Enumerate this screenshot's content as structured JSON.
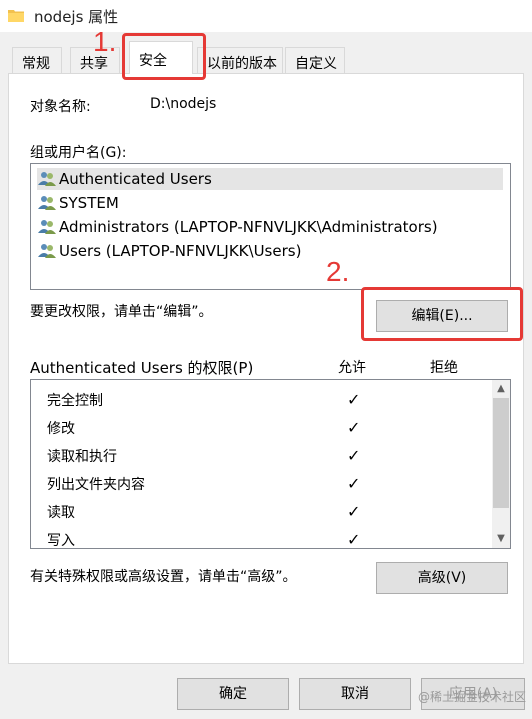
{
  "window": {
    "title": "nodejs 属性",
    "folder_icon": "folder-icon"
  },
  "tabs": [
    {
      "label": "常规",
      "active": false
    },
    {
      "label": "共享",
      "active": false
    },
    {
      "label": "安全",
      "active": true
    },
    {
      "label": "以前的版本",
      "active": false
    },
    {
      "label": "自定义",
      "active": false
    }
  ],
  "security": {
    "object_name_label": "对象名称:",
    "object_name_value": "D:\\nodejs",
    "groups_label": "组或用户名(G):",
    "groups": [
      {
        "name": "Authenticated Users",
        "selected": true,
        "icon": "users-icon"
      },
      {
        "name": "SYSTEM",
        "selected": false,
        "icon": "users-icon"
      },
      {
        "name": "Administrators (LAPTOP-NFNVLJKK\\Administrators)",
        "selected": false,
        "icon": "users-icon"
      },
      {
        "name": "Users (LAPTOP-NFNVLJKK\\Users)",
        "selected": false,
        "icon": "users-icon"
      }
    ],
    "change_hint": "要更改权限，请单击“编辑”。",
    "edit_button": "编辑(E)...",
    "permissions_label": "Authenticated Users 的权限(P)",
    "allow_header": "允许",
    "deny_header": "拒绝",
    "permissions": [
      {
        "name": "完全控制",
        "allow": true,
        "deny": false
      },
      {
        "name": "修改",
        "allow": true,
        "deny": false
      },
      {
        "name": "读取和执行",
        "allow": true,
        "deny": false
      },
      {
        "name": "列出文件夹内容",
        "allow": true,
        "deny": false
      },
      {
        "name": "读取",
        "allow": true,
        "deny": false
      },
      {
        "name": "写入",
        "allow": true,
        "deny": false
      }
    ],
    "advanced_hint": "有关特殊权限或高级设置，请单击“高级”。",
    "advanced_button": "高级(V)"
  },
  "footer": {
    "ok_label": "确定",
    "cancel_label": "取消",
    "apply_label": "应用(A)"
  },
  "annotations": {
    "step1": "1.",
    "step2": "2.",
    "color": "#e53935"
  },
  "watermark": "@稀土掘金技术社区",
  "check_mark": "✓"
}
